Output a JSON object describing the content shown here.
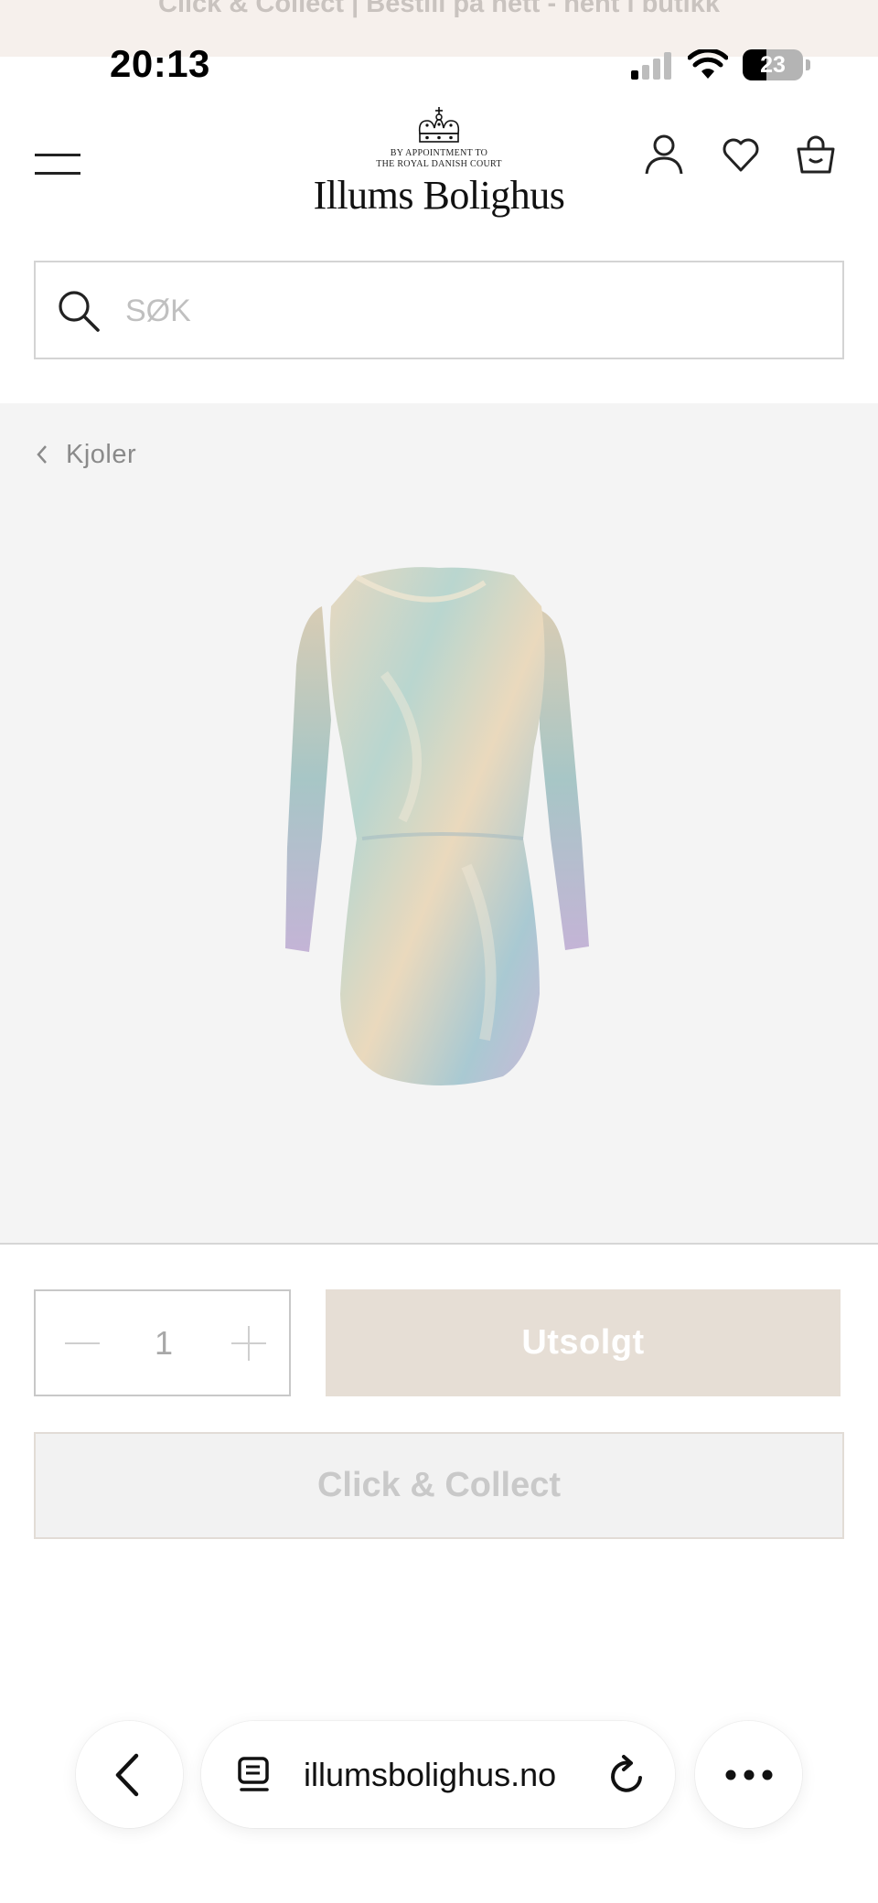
{
  "promo": {
    "text": "Click & Collect | Bestill på nett - hent i butikk"
  },
  "status_bar": {
    "time": "20:13",
    "battery": "23",
    "battery_level": 0.23
  },
  "header": {
    "appointment_line1": "BY APPOINTMENT TO",
    "appointment_line2": "THE ROYAL DANISH COURT",
    "brand": "Illums Bolighus",
    "icons": [
      "menu-icon",
      "account-icon",
      "heart-icon",
      "bag-icon"
    ]
  },
  "search": {
    "placeholder": "SØK",
    "value": ""
  },
  "breadcrumb": {
    "label": "Kjoler"
  },
  "product": {
    "image_icon": "sequin-dress-image"
  },
  "purchase": {
    "quantity": "1",
    "soldout_label": "Utsolgt",
    "click_collect_label": "Click & Collect"
  },
  "browser": {
    "url": "illumsbolighus.no",
    "icons": [
      "back-icon",
      "tabs-icon",
      "reload-icon",
      "more-icon"
    ]
  },
  "colors": {
    "soldout_bg": "#e6ded5",
    "gallery_bg": "#f4f4f4",
    "promo_bg": "#f6f0ec"
  }
}
